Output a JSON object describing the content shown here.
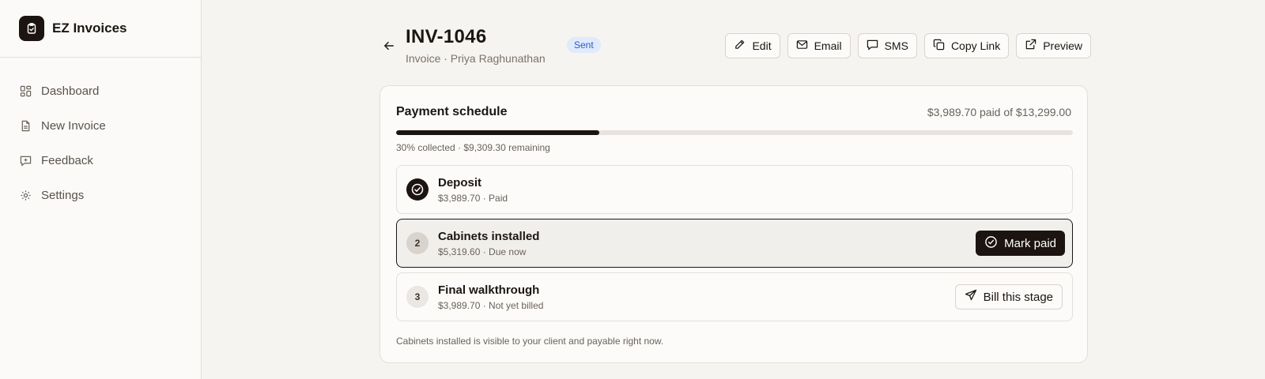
{
  "app": {
    "name": "EZ Invoices"
  },
  "sidebar": {
    "items": [
      {
        "label": "Dashboard",
        "icon": "dashboard-icon"
      },
      {
        "label": "New Invoice",
        "icon": "document-icon"
      },
      {
        "label": "Feedback",
        "icon": "feedback-icon"
      },
      {
        "label": "Settings",
        "icon": "gear-icon"
      }
    ]
  },
  "invoice": {
    "number": "INV-1046",
    "subtitle": "Invoice · Priya Raghunathan",
    "status": "Sent"
  },
  "actions": {
    "edit": "Edit",
    "email": "Email",
    "sms": "SMS",
    "copy_link": "Copy Link",
    "preview": "Preview"
  },
  "schedule": {
    "title": "Payment schedule",
    "total": "$3,989.70 paid of $13,299.00",
    "progress_fraction": 0.3,
    "progress_text": "30% collected · $9,309.30 remaining",
    "stages": [
      {
        "number": "1",
        "name": "Deposit",
        "meta": "$3,989.70 · Paid",
        "state": "paid"
      },
      {
        "number": "2",
        "name": "Cabinets installed",
        "meta": "$5,319.60 · Due now",
        "state": "due",
        "action": "Mark paid"
      },
      {
        "number": "3",
        "name": "Final walkthrough",
        "meta": "$3,989.70 · Not yet billed",
        "state": "unbilled",
        "action": "Bill this stage"
      }
    ],
    "footnote": "Cabinets installed is visible to your client and payable right now."
  },
  "colors": {
    "accent": "#1c1410",
    "badge_bg": "#dfeafb",
    "badge_text": "#2c5cc5",
    "background": "#f6f4f1"
  }
}
